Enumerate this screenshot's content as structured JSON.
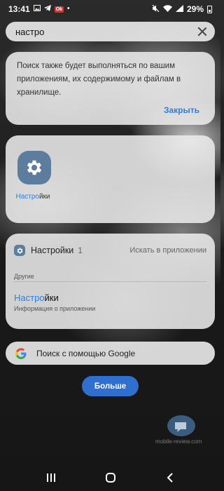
{
  "status_bar": {
    "time": "13:41",
    "badge": "Ok",
    "battery": "29%"
  },
  "search": {
    "query": "настро",
    "placeholder": ""
  },
  "notice": {
    "text": "Поиск также будет выполняться по вашим приложениям, их содержимому и файлам в хранилище.",
    "close_label": "Закрыть"
  },
  "apps": {
    "items": [
      {
        "label_match": "Настро",
        "label_rest": "йки",
        "icon": "gear-icon"
      }
    ]
  },
  "results": {
    "app_title": "Настройки",
    "count": "1",
    "search_in_app": "Искать в приложении",
    "section_label": "Другие",
    "item_match": "Настро",
    "item_rest": "йки",
    "item_subtitle": "Информация о приложении"
  },
  "google": {
    "label": "Поиск с помощью Google"
  },
  "more_button": {
    "label": "Больше"
  },
  "watermark": {
    "text": "mobile-review.com"
  },
  "colors": {
    "accent": "#2f7de1",
    "button": "#2f6fcf",
    "app_icon": "#5c7d9e"
  }
}
